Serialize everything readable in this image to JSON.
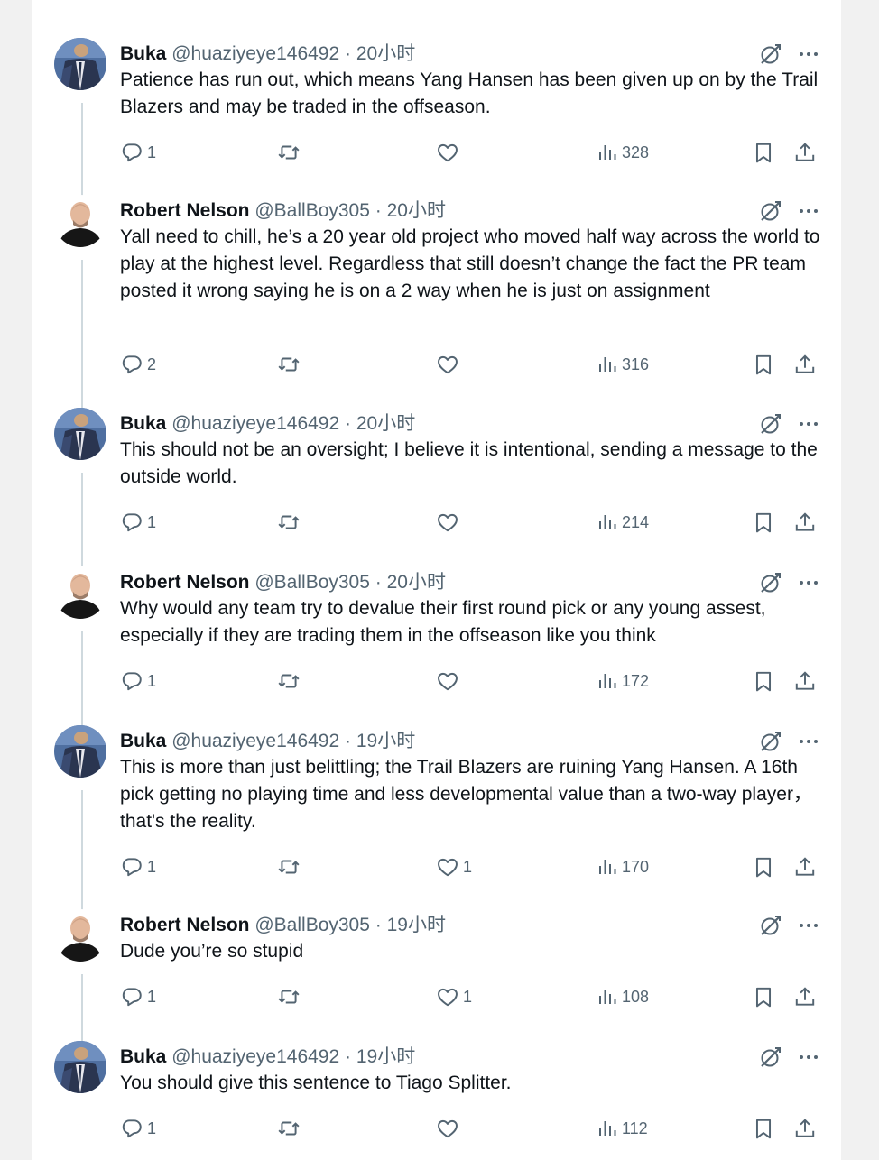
{
  "tweets": [
    {
      "author": "Buka",
      "handle": "@huaziyeye146492",
      "time": "20小时",
      "text": "Patience has run out, which means Yang Hansen has been given up on by the Trail Blazers and may be traded in the offseason.",
      "replies": "1",
      "retweets": "",
      "likes": "",
      "views": "328",
      "avatar": "buka"
    },
    {
      "author": "Robert Nelson",
      "handle": "@BallBoy305",
      "time": "20小时",
      "text": "Yall need to chill, he’s a 20 year old project who moved half way across the world to play at the highest level. Regardless that still doesn’t change the fact the PR team posted it wrong saying he is on a 2 way when he is just on assignment",
      "replies": "2",
      "retweets": "",
      "likes": "",
      "views": "316",
      "avatar": "robert"
    },
    {
      "author": "Buka",
      "handle": "@huaziyeye146492",
      "time": "20小时",
      "text": "This should not be an oversight; I believe it is intentional, sending a message to the outside world.",
      "replies": "1",
      "retweets": "",
      "likes": "",
      "views": "214",
      "avatar": "buka"
    },
    {
      "author": "Robert Nelson",
      "handle": "@BallBoy305",
      "time": "20小时",
      "text": "Why would any team try to devalue their first round pick or any young assest, especially if they are trading them in the offseason like you think",
      "replies": "1",
      "retweets": "",
      "likes": "",
      "views": "172",
      "avatar": "robert"
    },
    {
      "author": "Buka",
      "handle": "@huaziyeye146492",
      "time": "19小时",
      "text": "This is more than just belittling; the Trail Blazers are ruining Yang Hansen. A 16th pick getting no playing time and less developmental value than a two-way player，that's the reality.",
      "replies": "1",
      "retweets": "",
      "likes": "1",
      "views": "170",
      "avatar": "buka"
    },
    {
      "author": "Robert Nelson",
      "handle": "@BallBoy305",
      "time": "19小时",
      "text": "Dude you’re so stupid",
      "replies": "1",
      "retweets": "",
      "likes": "1",
      "views": "108",
      "avatar": "robert"
    },
    {
      "author": "Buka",
      "handle": "@huaziyeye146492",
      "time": "19小时",
      "text": "You should give this sentence to Tiago Splitter.",
      "replies": "1",
      "retweets": "",
      "likes": "",
      "views": "112",
      "avatar": "buka"
    }
  ],
  "separator": "·",
  "icons": {
    "reply": "reply-icon",
    "retweet": "retweet-icon",
    "like": "heart-icon",
    "views": "views-icon",
    "bookmark": "bookmark-icon",
    "share": "share-icon",
    "grok": "grok-icon",
    "more": "more-icon"
  },
  "colors": {
    "text": "#0f1419",
    "secondary": "#536471",
    "thread_line": "#cfd9de",
    "page_bg": "#f1f1f1",
    "card_bg": "#ffffff"
  }
}
